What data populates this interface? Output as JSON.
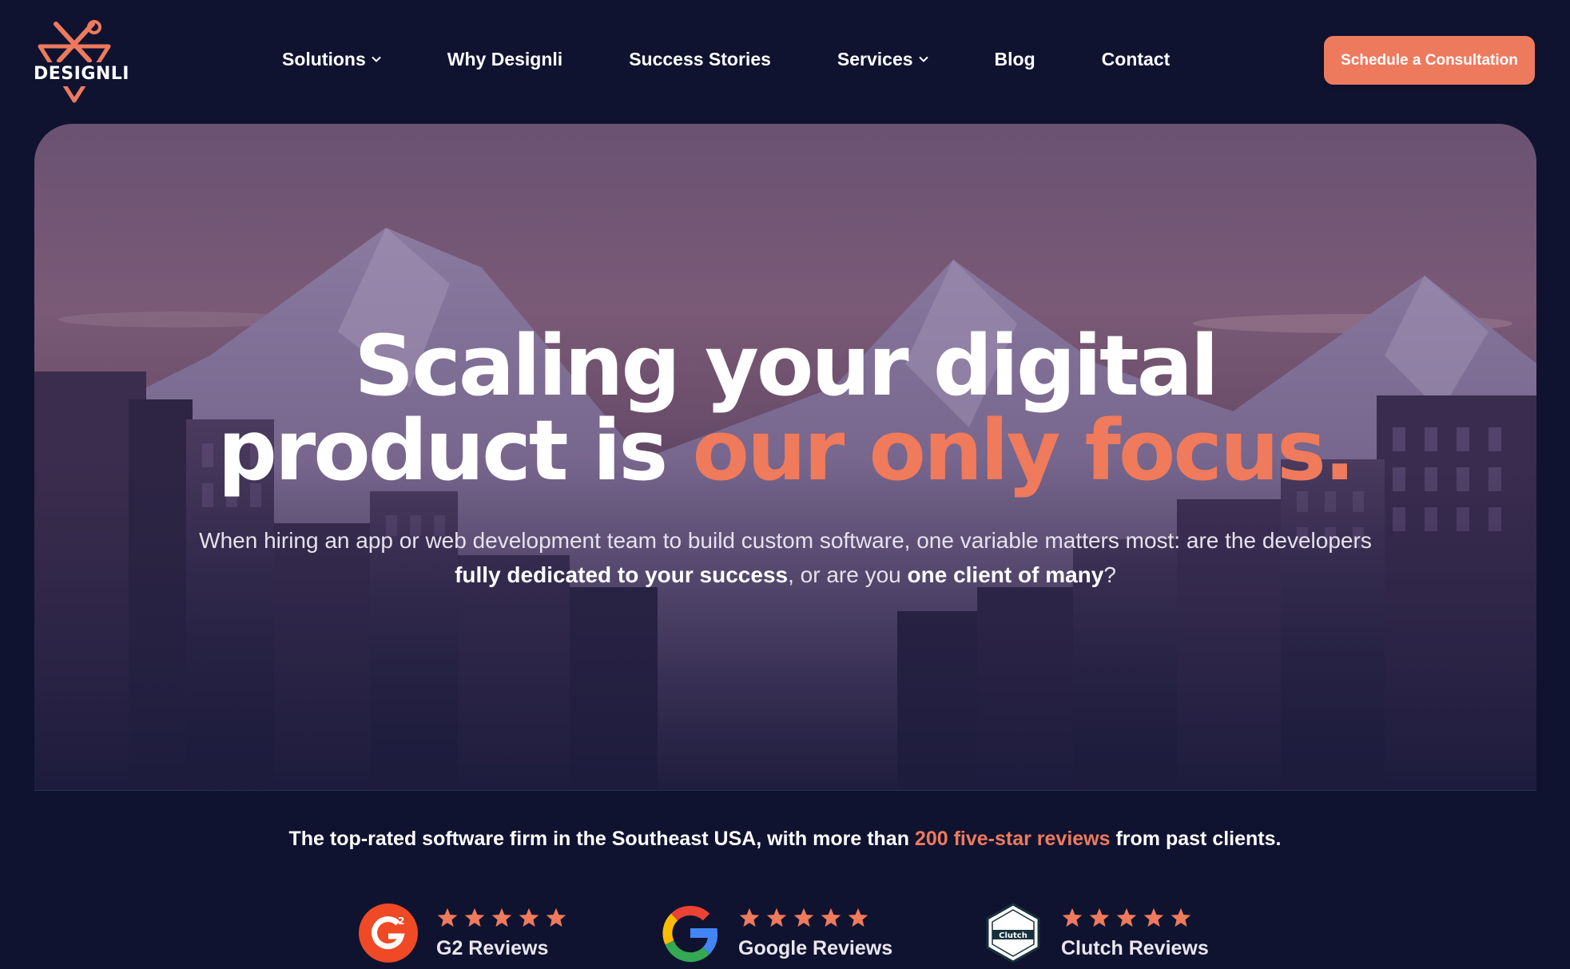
{
  "header": {
    "logo_text": "DESIGNLI",
    "nav": [
      {
        "label": "Solutions",
        "has_dropdown": true
      },
      {
        "label": "Why Designli",
        "has_dropdown": false
      },
      {
        "label": "Success Stories",
        "has_dropdown": false
      },
      {
        "label": "Services",
        "has_dropdown": true
      },
      {
        "label": "Blog",
        "has_dropdown": false
      },
      {
        "label": "Contact",
        "has_dropdown": false
      }
    ],
    "cta_label": "Schedule a Consultation"
  },
  "hero": {
    "title_line1": "Scaling your digital",
    "title_line2_prefix": "product is ",
    "title_line2_accent": "our only focus.",
    "sub_part1": "When hiring an app or web development team to build custom software, one variable matters most: are the developers ",
    "sub_bold1": "fully dedicated to your success",
    "sub_part2": ", or are you ",
    "sub_bold2": "one client of many",
    "sub_part3": "?"
  },
  "reviews": {
    "tagline_part1": "The top-rated software firm in the Southeast USA, with more than ",
    "tagline_highlight": "200 five-star reviews",
    "tagline_part2": " from past clients.",
    "items": [
      {
        "label": "G2 Reviews",
        "icon": "g2-logo-icon",
        "stars": 5
      },
      {
        "label": "Google Reviews",
        "icon": "google-logo-icon",
        "stars": 5
      },
      {
        "label": "Clutch Reviews",
        "icon": "clutch-badge-icon",
        "stars": 5,
        "badge_text": "Clutch"
      }
    ]
  },
  "colors": {
    "background": "#0f1330",
    "accent": "#ee7a5e",
    "white": "#ffffff"
  }
}
